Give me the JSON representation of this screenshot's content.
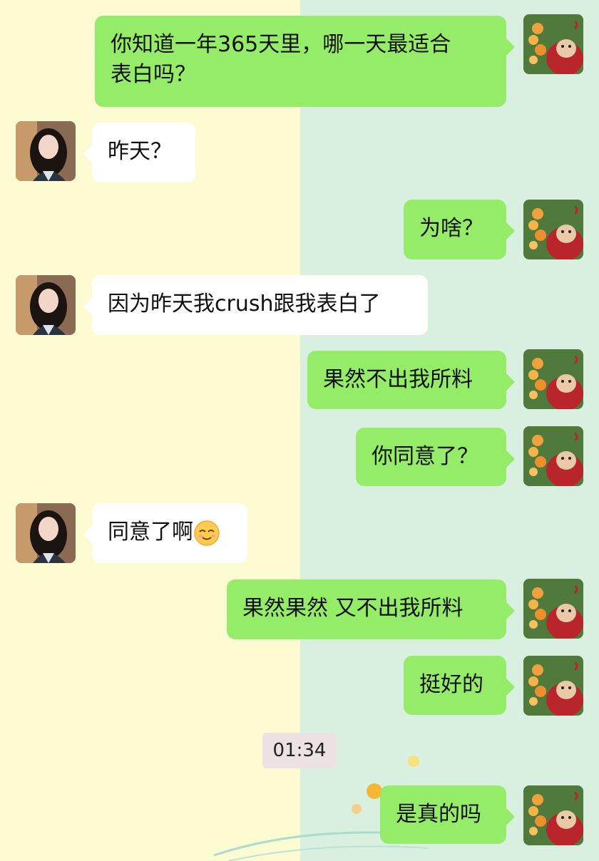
{
  "messages": [
    {
      "side": "right",
      "text": "你知道一年365天里，哪一天最适合",
      "text2": "表白吗？"
    },
    {
      "side": "left",
      "text": "昨天？"
    },
    {
      "side": "right",
      "text": "为啥？"
    },
    {
      "side": "left",
      "text": "因为昨天我crush跟我表白了"
    },
    {
      "side": "right",
      "text": "果然不出我所料"
    },
    {
      "side": "right",
      "text": "你同意了？"
    },
    {
      "side": "left",
      "text": "同意了啊",
      "emoji": "smiling-face-with-closed-eyes-emoji"
    },
    {
      "side": "right",
      "text": "果然果然 又不出我所料"
    },
    {
      "side": "right",
      "text": "挺好的"
    },
    {
      "side": "right",
      "text": "是真的吗"
    }
  ],
  "timestamp": "01:34",
  "colors": {
    "left_background": "#fdfbd1",
    "right_background": "#d9efdf",
    "outgoing_bubble": "#95ec69",
    "incoming_bubble": "#ffffff",
    "timestamp_background": "#ede2e3"
  },
  "avatars": {
    "right": "red-cartoon-character-with-balloons-avatar",
    "left": "girl-with-long-dark-hair-avatar"
  }
}
